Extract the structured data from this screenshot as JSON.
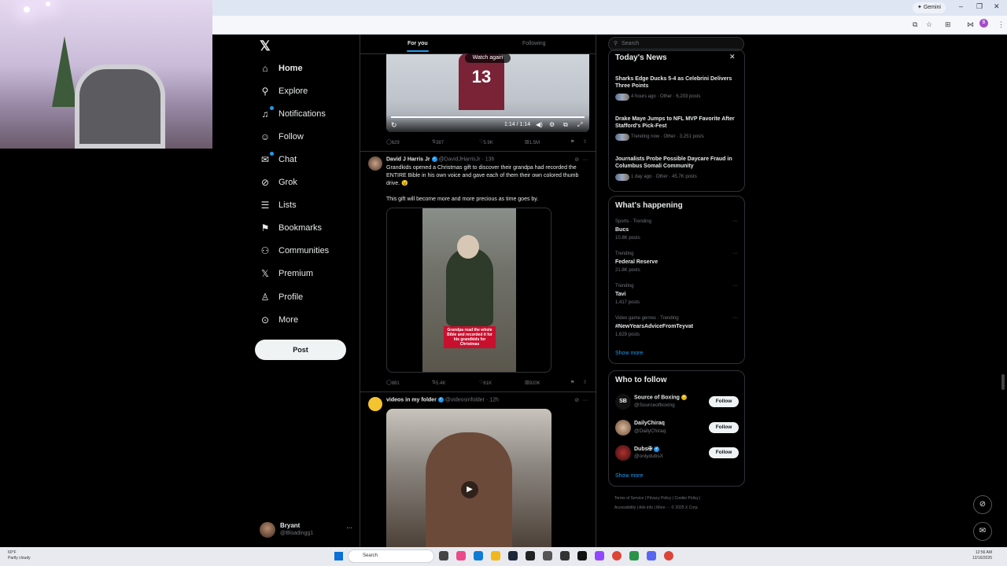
{
  "browser": {
    "gemini_label": "Gemini",
    "minimize": "–",
    "restore": "❐",
    "close": "✕",
    "profile_initial": "B"
  },
  "nav": {
    "items": [
      {
        "label": "Home",
        "icon": "home-icon"
      },
      {
        "label": "Explore",
        "icon": "search-icon"
      },
      {
        "label": "Notifications",
        "icon": "bell-icon"
      },
      {
        "label": "Follow",
        "icon": "person-add-icon"
      },
      {
        "label": "Chat",
        "icon": "chat-icon"
      },
      {
        "label": "Grok",
        "icon": "grok-icon"
      },
      {
        "label": "Lists",
        "icon": "list-icon"
      },
      {
        "label": "Bookmarks",
        "icon": "bookmark-icon"
      },
      {
        "label": "Communities",
        "icon": "communities-icon"
      },
      {
        "label": "Premium",
        "icon": "x-icon"
      },
      {
        "label": "Profile",
        "icon": "profile-icon"
      },
      {
        "label": "More",
        "icon": "more-circle-icon"
      }
    ],
    "post_label": "Post",
    "user": {
      "name": "Bryant",
      "handle": "@Bloadingg1",
      "more": "···"
    }
  },
  "timeline": {
    "tabs": {
      "for_you": "For you",
      "following": "Following"
    },
    "video1": {
      "watch_again": "Watch again",
      "time": "1:14 / 1:14",
      "jersey_number": "13",
      "stats": {
        "replies": "629",
        "reposts": "387",
        "likes": "5.9K",
        "views": "1.5M"
      }
    },
    "tweet2": {
      "name": "David J Harris Jr",
      "handle": "@DavidJHarrisJr",
      "time": "· 13h",
      "text1": "Grandkids opened a Christmas gift to discover their grandpa had recorded the ENTIRE Bible in his own voice and gave each of them their own colored thumb drive. 😉",
      "text2": "This gift will become more and more precious as time goes by.",
      "caption": "Grandpa read the whole Bible and recorded it for his grandkids for Christmas",
      "stats": {
        "replies": "881",
        "reposts": "5.4K",
        "likes": "61K",
        "views": "920K"
      }
    },
    "tweet3": {
      "name": "videos in my folder",
      "handle": "@videosinfolder",
      "time": "· 12h"
    }
  },
  "sidebar": {
    "search_placeholder": "Search",
    "news": {
      "title": "Today's News",
      "close": "✕",
      "items": [
        {
          "headline": "Sharks Edge Ducks 5-4 as Celebrini Delivers Three Points",
          "meta": "4 hours ago · Other · 6,203 posts"
        },
        {
          "headline": "Drake Maye Jumps to NFL MVP Favorite After Stafford's Pick-Fest",
          "meta": "Trending now · Other · 3,251 posts"
        },
        {
          "headline": "Journalists Probe Possible Daycare Fraud in Columbus Somali Community",
          "meta": "1 day ago · Other · 45.7K posts"
        }
      ]
    },
    "happening": {
      "title": "What's happening",
      "items": [
        {
          "category": "Sports · Trending",
          "name": "Bucs",
          "count": "10.8K posts"
        },
        {
          "category": "Trending",
          "name": "Federal Reserve",
          "count": "21.8K posts"
        },
        {
          "category": "Trending",
          "name": "Tavi",
          "count": "1,417 posts"
        },
        {
          "category": "Video game genres · Trending",
          "name": "#NewYearsAdviceFromTeyvat",
          "count": "1,629 posts"
        }
      ],
      "show_more": "Show more"
    },
    "who_to_follow": {
      "title": "Who to follow",
      "items": [
        {
          "name": "Source of Boxing",
          "handle": "@Sourceofboxing",
          "avatar_text": "SB",
          "button": "Follow"
        },
        {
          "name": "DailyChiraq",
          "handle": "@DailyChiraq",
          "button": "Follow"
        },
        {
          "name": "Dubs✠",
          "handle": "@onlydubsX",
          "button": "Follow"
        }
      ],
      "show_more": "Show more"
    },
    "footer": {
      "line1": "Terms of Service | Privacy Policy | Cookie Policy |",
      "line2": "Accessibility | Ads info | More ··· © 2025 X Corp."
    }
  },
  "taskbar": {
    "weather_temp": "60°F",
    "weather_desc": "Partly cloudy",
    "search_placeholder": "Search",
    "time": "12:56 AM",
    "date": "12/16/2025"
  },
  "colors": {
    "accent": "#1d9bf0",
    "background": "#000000",
    "border": "#2f3336",
    "muted": "#71767b"
  }
}
